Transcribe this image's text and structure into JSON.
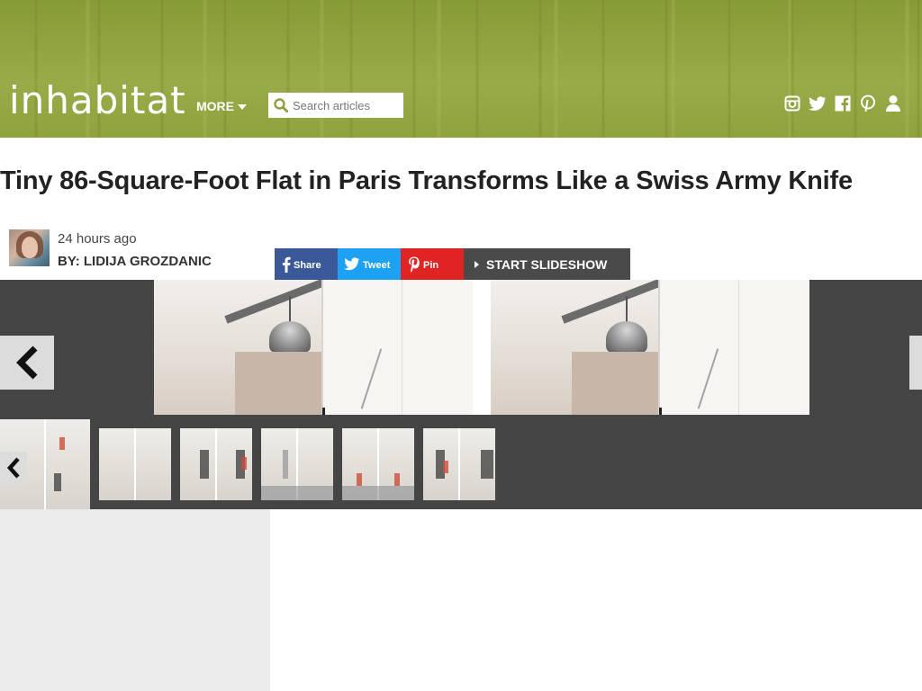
{
  "site": {
    "logo": "inhabitat",
    "more_label": "MORE"
  },
  "search": {
    "placeholder": "Search articles",
    "value": ""
  },
  "social_icons": [
    "instagram-icon",
    "twitter-icon",
    "facebook-icon",
    "pinterest-icon",
    "user-icon"
  ],
  "article": {
    "title": "Tiny 86-Square-Foot Flat in Paris Transforms Like a Swiss Army Knife",
    "time_ago": "24 hours ago",
    "byline": "BY: LIDIJA GROZDANIC"
  },
  "share": {
    "facebook_label": "Share",
    "twitter_label": "Tweet",
    "pinterest_label": "Pin",
    "slideshow_label": "START SLIDESHOW"
  },
  "colors": {
    "header_green": "#8fa13e",
    "facebook": "#3b5998",
    "twitter": "#1da1f2",
    "pinterest": "#e02323",
    "slideshow_bg": "#454545"
  },
  "slideshow": {
    "thumbnail_count": 6,
    "active_thumbnail": 1
  }
}
